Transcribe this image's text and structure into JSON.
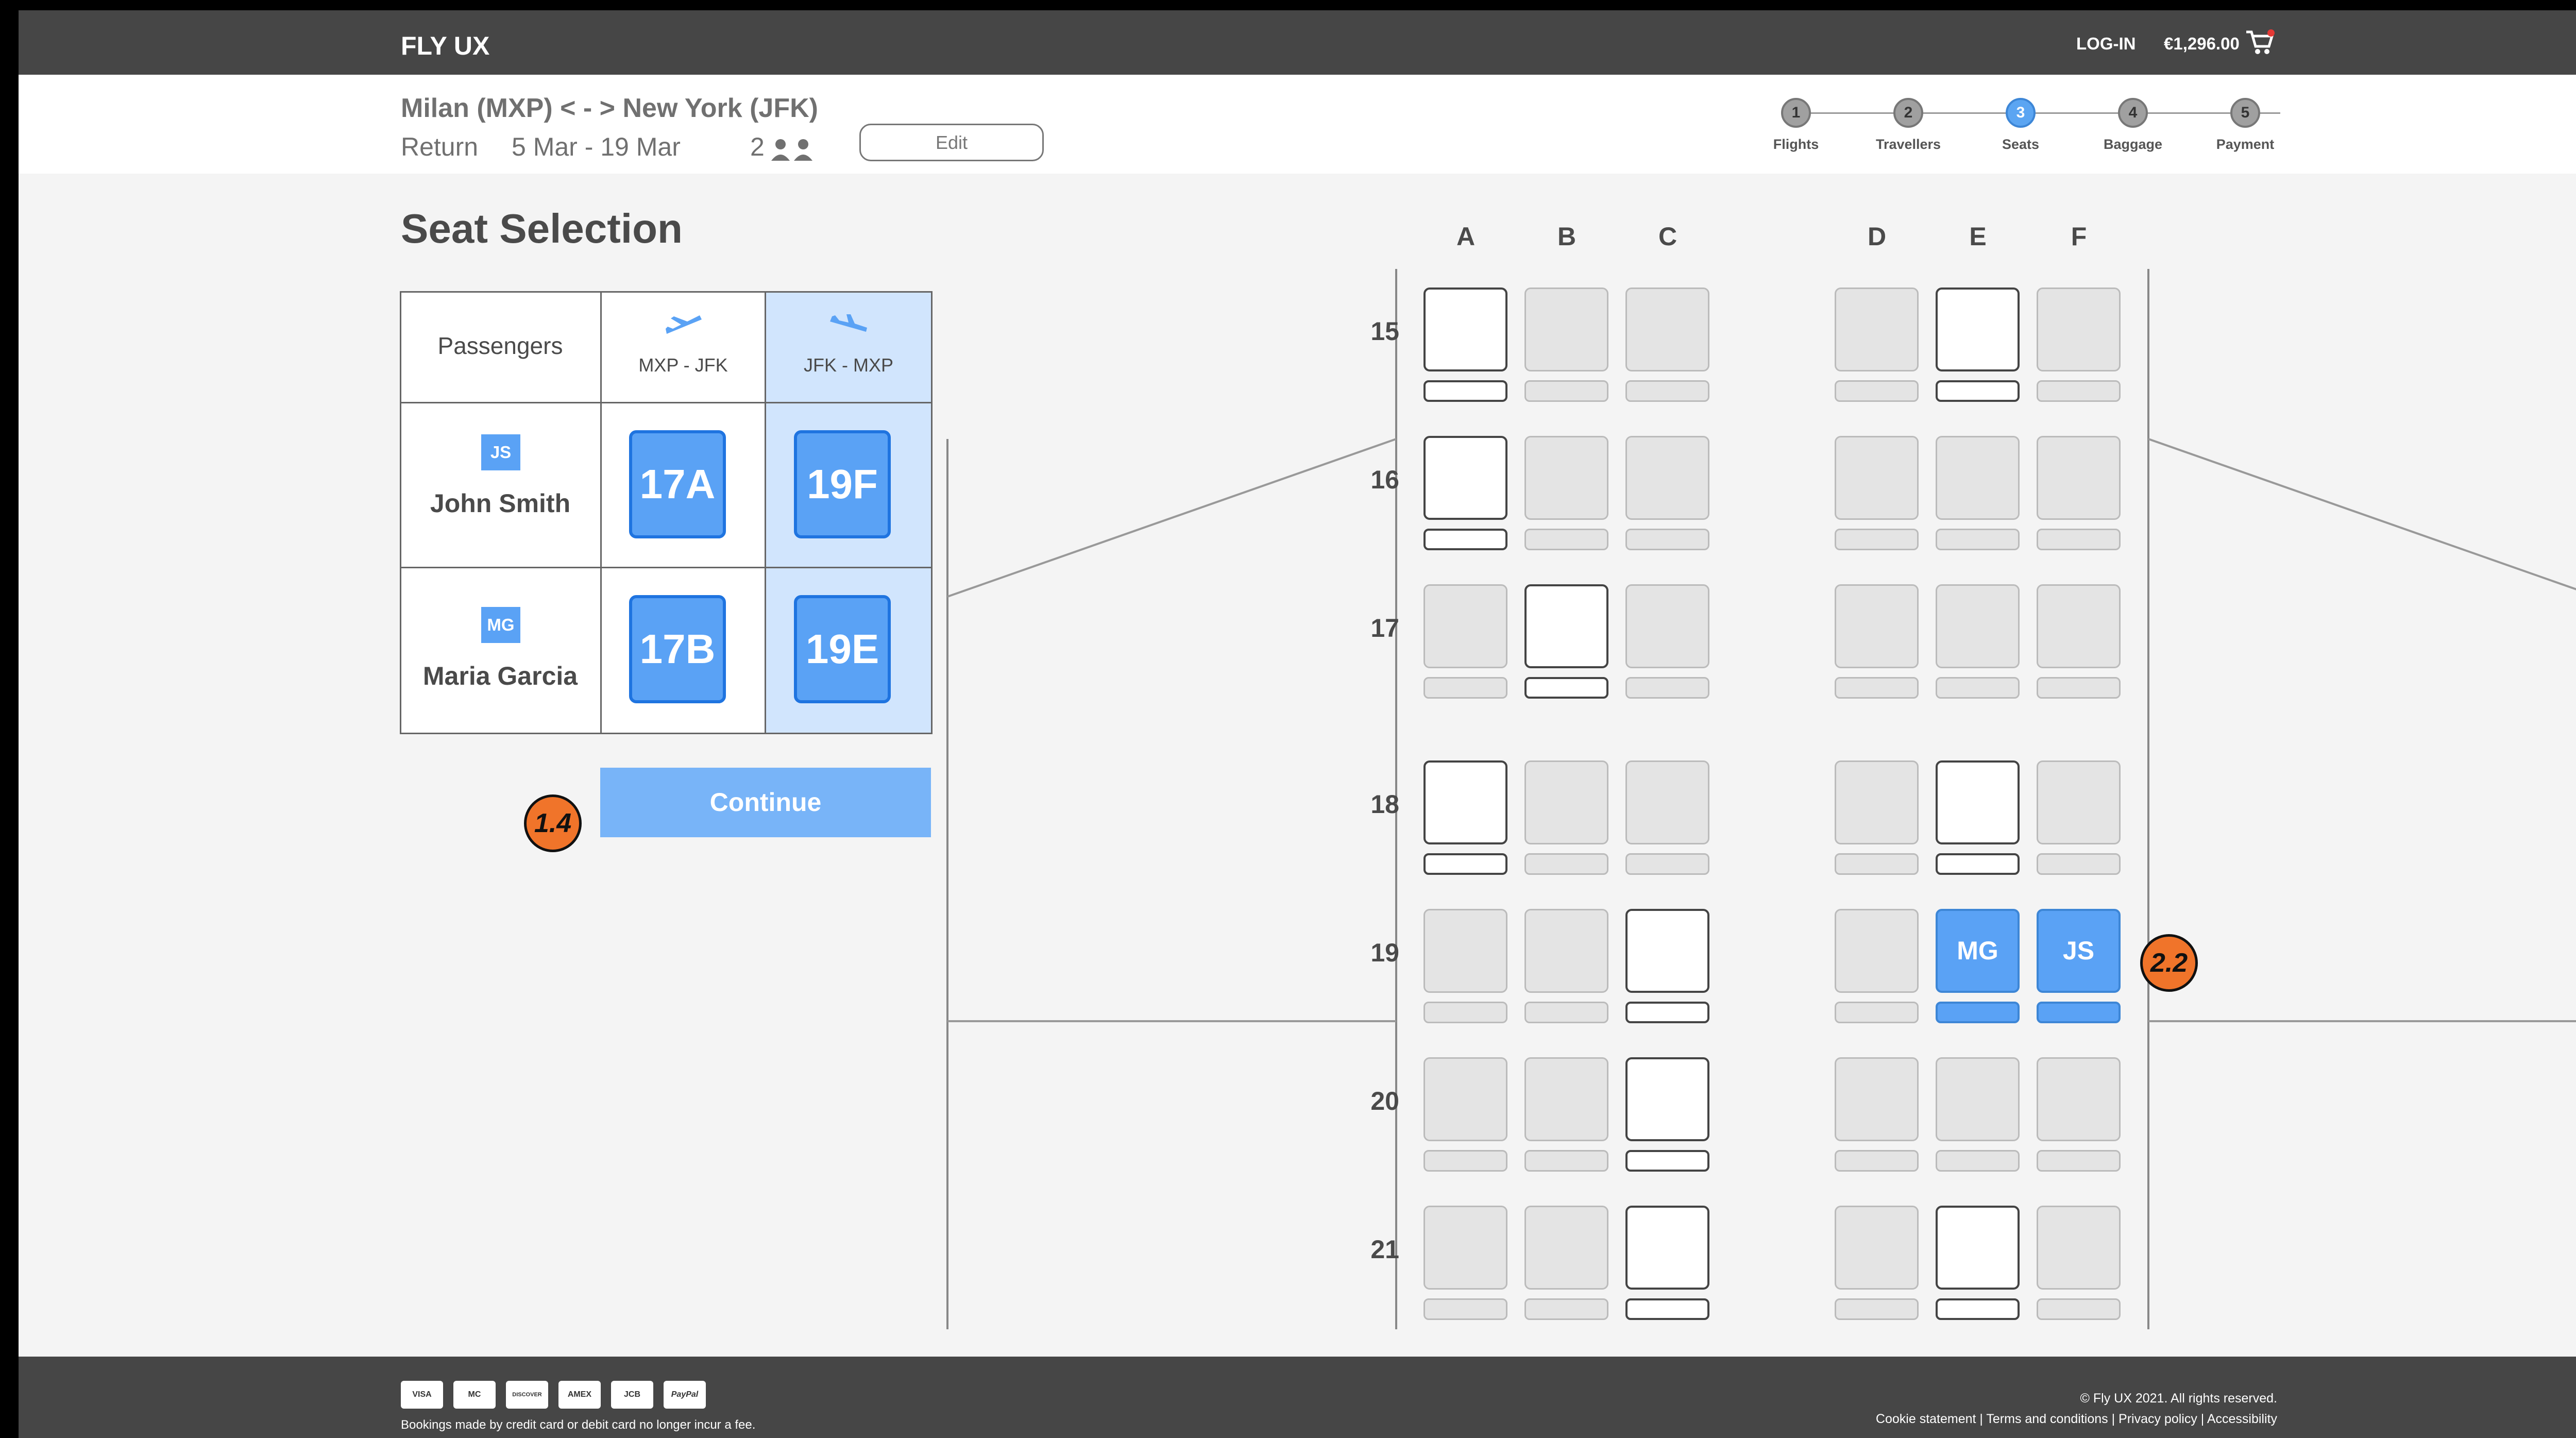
{
  "header": {
    "brand": "FLY UX",
    "login_label": "LOG-IN",
    "cart_total": "€1,296.00",
    "cart_icon": "shopping-cart-icon"
  },
  "trip": {
    "route": "Milan (MXP) < - > New York (JFK)",
    "type": "Return",
    "dates": "5 Mar - 19 Mar",
    "passenger_count": "2",
    "edit_label": "Edit"
  },
  "steps": [
    {
      "number": "1",
      "label": "Flights",
      "active": false
    },
    {
      "number": "2",
      "label": "Travellers",
      "active": false
    },
    {
      "number": "3",
      "label": "Seats",
      "active": true
    },
    {
      "number": "4",
      "label": "Baggage",
      "active": false
    },
    {
      "number": "5",
      "label": "Payment",
      "active": false
    }
  ],
  "page_title": "Seat Selection",
  "passenger_table": {
    "header_label": "Passengers",
    "outbound_label": "MXP - JFK",
    "return_label": "JFK - MXP",
    "passengers": [
      {
        "initials": "JS",
        "name": "John Smith",
        "outbound_seat": "17A",
        "return_seat": "19F"
      },
      {
        "initials": "MG",
        "name": "Maria Garcia",
        "outbound_seat": "17B",
        "return_seat": "19E"
      }
    ]
  },
  "continue_label": "Continue",
  "callouts": {
    "continue": "1.4",
    "seats": "2.2"
  },
  "seat_map": {
    "columns": [
      "A",
      "B",
      "C",
      "D",
      "E",
      "F"
    ],
    "rows": [
      {
        "number": "15",
        "seats": [
          "free",
          "taken",
          "taken",
          "taken",
          "free",
          "taken"
        ]
      },
      {
        "number": "16",
        "seats": [
          "free",
          "taken",
          "taken",
          "taken",
          "taken",
          "taken"
        ]
      },
      {
        "number": "17",
        "seats": [
          "taken",
          "free",
          "taken",
          "taken",
          "taken",
          "taken"
        ]
      },
      {
        "number": "18",
        "seats": [
          "free",
          "taken",
          "taken",
          "taken",
          "free",
          "taken"
        ]
      },
      {
        "number": "19",
        "seats": [
          "taken",
          "taken",
          "free",
          "taken",
          "selected",
          "selected"
        ]
      },
      {
        "number": "20",
        "seats": [
          "taken",
          "taken",
          "free",
          "taken",
          "taken",
          "taken"
        ]
      },
      {
        "number": "21",
        "seats": [
          "taken",
          "taken",
          "free",
          "taken",
          "free",
          "taken"
        ]
      }
    ],
    "selected_labels": {
      "19E": "MG",
      "19F": "JS"
    }
  },
  "footer": {
    "cards": [
      "VISA",
      "MC",
      "DISCOVER",
      "AMEX",
      "JCB",
      "PayPal"
    ],
    "note": "Bookings made by credit card or debit card no longer incur a fee.",
    "copyright": "© Fly UX 2021. All rights reserved.",
    "links": "Cookie statement | Terms and conditions | Privacy policy | Accessibility"
  }
}
